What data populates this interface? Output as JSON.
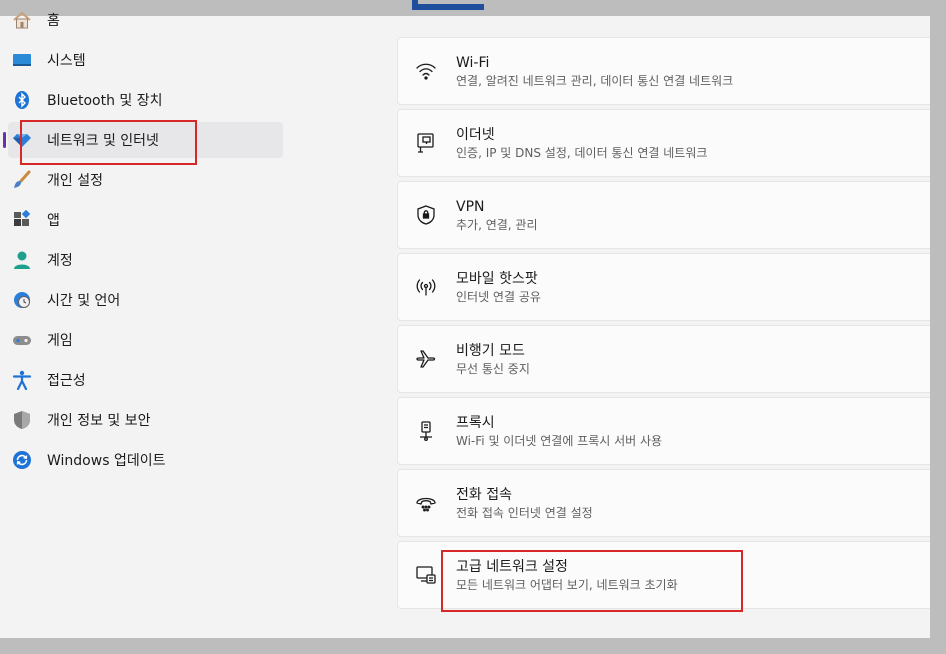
{
  "sidebar": {
    "items": [
      {
        "label": "홈",
        "icon": "home-icon"
      },
      {
        "label": "시스템",
        "icon": "system-icon"
      },
      {
        "label": "Bluetooth 및 장치",
        "icon": "bluetooth-icon"
      },
      {
        "label": "네트워크 및 인터넷",
        "icon": "network-icon",
        "selected": true
      },
      {
        "label": "개인 설정",
        "icon": "brush-icon"
      },
      {
        "label": "앱",
        "icon": "apps-icon"
      },
      {
        "label": "계정",
        "icon": "account-icon"
      },
      {
        "label": "시간 및 언어",
        "icon": "time-language-icon"
      },
      {
        "label": "게임",
        "icon": "gamepad-icon"
      },
      {
        "label": "접근성",
        "icon": "accessibility-icon"
      },
      {
        "label": "개인 정보 및 보안",
        "icon": "shield-icon"
      },
      {
        "label": "Windows 업데이트",
        "icon": "update-icon"
      }
    ]
  },
  "cards": [
    {
      "title": "Wi-Fi",
      "subtitle": "연결, 알려진 네트워크 관리, 데이터 통신 연결 네트워크",
      "icon": "wifi-icon"
    },
    {
      "title": "이더넷",
      "subtitle": "인증, IP 및 DNS 설정, 데이터 통신 연결 네트워크",
      "icon": "ethernet-icon"
    },
    {
      "title": "VPN",
      "subtitle": "추가, 연결, 관리",
      "icon": "vpn-shield-icon"
    },
    {
      "title": "모바일 핫스팟",
      "subtitle": "인터넷 연결 공유",
      "icon": "hotspot-icon"
    },
    {
      "title": "비행기 모드",
      "subtitle": "무선 통신 중지",
      "icon": "airplane-icon"
    },
    {
      "title": "프록시",
      "subtitle": "Wi-Fi 및 이더넷 연결에 프록시 서버 사용",
      "icon": "proxy-icon"
    },
    {
      "title": "전화 접속",
      "subtitle": "전화 접속 인터넷 연결 설정",
      "icon": "dialup-icon"
    },
    {
      "title": "고급 네트워크 설정",
      "subtitle": "모든 네트워크 어댑터 보기, 네트워크 초기화",
      "icon": "advanced-network-icon"
    }
  ],
  "colors": {
    "accent": "#6b2fa8",
    "highlight": "#d62828",
    "window_bg": "#f3f3f3",
    "card_bg": "#fbfbfb"
  }
}
